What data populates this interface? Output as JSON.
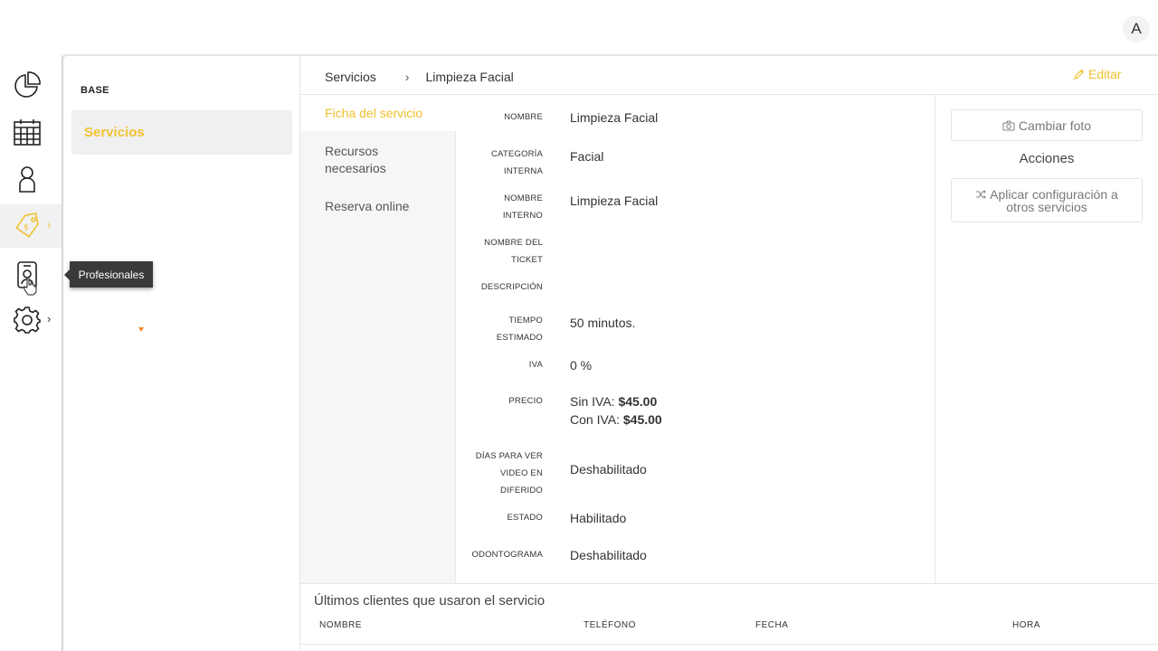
{
  "user": {
    "avatar_letter": "A"
  },
  "rail": {
    "items": [
      {
        "icon": "pie-chart-icon"
      },
      {
        "icon": "calendar-icon"
      },
      {
        "icon": "user-icon"
      },
      {
        "icon": "price-tag-icon",
        "active": true
      },
      {
        "icon": "professional-badge-icon"
      },
      {
        "icon": "gear-icon"
      }
    ],
    "tooltip": "Profesionales"
  },
  "sidebar": {
    "section": "BASE",
    "items": [
      {
        "label": "Servicios"
      }
    ]
  },
  "breadcrumb": {
    "root": "Servicios",
    "separator": "›",
    "current": "Limpieza Facial"
  },
  "toolbar": {
    "edit_label": "Editar"
  },
  "tabs": [
    {
      "label": "Ficha del servicio",
      "active": true
    },
    {
      "label": "Recursos necesarios"
    },
    {
      "label": "Reserva online"
    }
  ],
  "fields": {
    "nombre": {
      "label": "NOMBRE",
      "value": "Limpieza Facial"
    },
    "categoria": {
      "label_1": "CATEGORÍA",
      "label_2": "INTERNA",
      "value": "Facial"
    },
    "nombre_interno": {
      "label_1": "NOMBRE",
      "label_2": "INTERNO",
      "value": "Limpieza Facial"
    },
    "nombre_ticket": {
      "label_1": "NOMBRE DEL",
      "label_2": "TICKET",
      "value": ""
    },
    "descripcion": {
      "label": "DESCRIPCIÓN",
      "value": ""
    },
    "tiempo": {
      "label_1": "TIEMPO",
      "label_2": "ESTIMADO",
      "value": "50 minutos."
    },
    "iva": {
      "label": "IVA",
      "value": "0 %"
    },
    "precio": {
      "label": "PRECIO",
      "sin_prefix": "Sin IVA:",
      "sin_value": "$45.00",
      "con_prefix": "Con IVA:",
      "con_value": "$45.00"
    },
    "dias": {
      "label_1": "DÍAS PARA VER",
      "label_2": "VIDEO EN",
      "label_3": "DIFERIDO",
      "value": "Deshabilitado"
    },
    "estado": {
      "label": "ESTADO",
      "value": "Habilitado"
    },
    "odontograma": {
      "label": "ODONTOGRAMA",
      "value": "Deshabilitado"
    }
  },
  "actions": {
    "change_photo": "Cambiar foto",
    "title": "Acciones",
    "apply_config_1": "Aplicar configuración a",
    "apply_config_2": "otros servicios"
  },
  "clients": {
    "title": "Últimos clientes que usaron el servicio",
    "columns": [
      "NOMBRE",
      "TELÉFONO",
      "FECHA",
      "HORA"
    ]
  },
  "colors": {
    "accent": "#f0c030",
    "tooltip_bg": "#3a3a3a"
  }
}
